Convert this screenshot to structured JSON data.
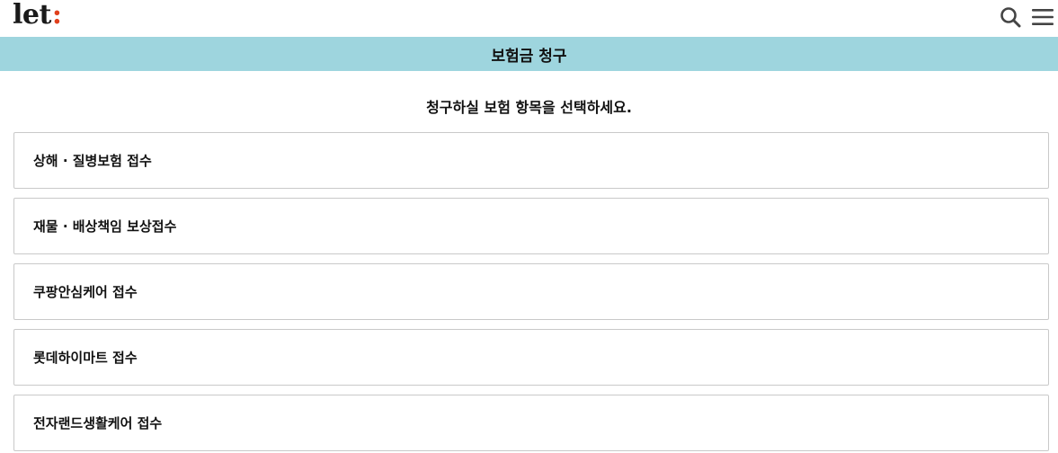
{
  "header": {
    "logo_text": "let",
    "logo_colon": ":",
    "logo_accent_color": "#e0401c",
    "icons": [
      "search-icon",
      "menu-icon"
    ]
  },
  "title_bar": {
    "title": "보험금 청구",
    "background_color": "#9ed5de"
  },
  "instruction": "청구하실 보험 항목을 선택하세요.",
  "options": [
    {
      "label": "상해 · 질병보험 접수"
    },
    {
      "label": "재물 · 배상책임 보상접수"
    },
    {
      "label": "쿠팡안심케어 접수"
    },
    {
      "label": "롯데하이마트 접수"
    },
    {
      "label": "전자랜드생활케어 접수"
    }
  ]
}
